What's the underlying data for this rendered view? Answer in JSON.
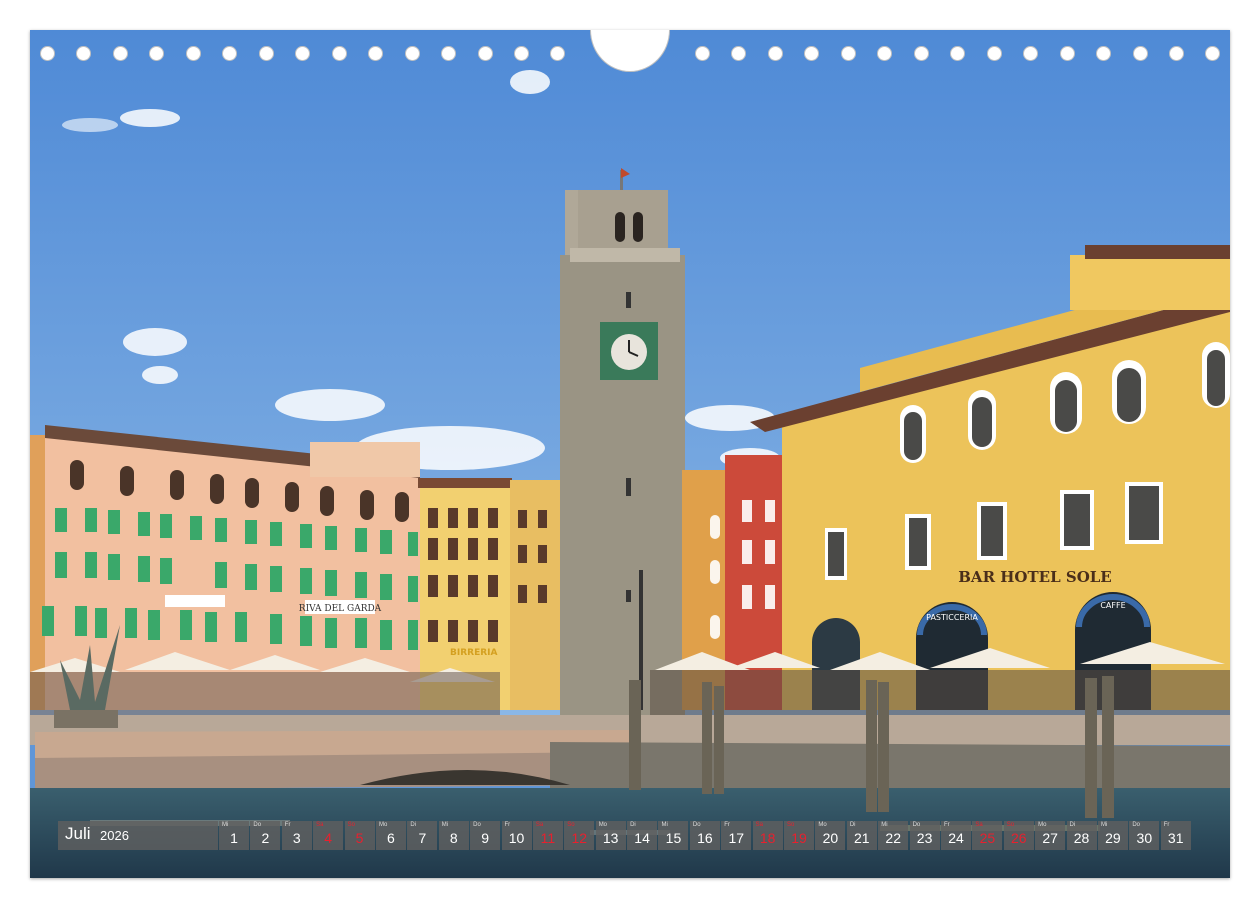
{
  "calendar": {
    "month": "Juli",
    "year": "2026",
    "days": [
      {
        "n": "1",
        "wd": "Mi",
        "weekend": false
      },
      {
        "n": "2",
        "wd": "Do",
        "weekend": false
      },
      {
        "n": "3",
        "wd": "Fr",
        "weekend": false
      },
      {
        "n": "4",
        "wd": "Sa",
        "weekend": true
      },
      {
        "n": "5",
        "wd": "So",
        "weekend": true
      },
      {
        "n": "6",
        "wd": "Mo",
        "weekend": false
      },
      {
        "n": "7",
        "wd": "Di",
        "weekend": false
      },
      {
        "n": "8",
        "wd": "Mi",
        "weekend": false
      },
      {
        "n": "9",
        "wd": "Do",
        "weekend": false
      },
      {
        "n": "10",
        "wd": "Fr",
        "weekend": false
      },
      {
        "n": "11",
        "wd": "Sa",
        "weekend": true
      },
      {
        "n": "12",
        "wd": "So",
        "weekend": true
      },
      {
        "n": "13",
        "wd": "Mo",
        "weekend": false
      },
      {
        "n": "14",
        "wd": "Di",
        "weekend": false
      },
      {
        "n": "15",
        "wd": "Mi",
        "weekend": false
      },
      {
        "n": "16",
        "wd": "Do",
        "weekend": false
      },
      {
        "n": "17",
        "wd": "Fr",
        "weekend": false
      },
      {
        "n": "18",
        "wd": "Sa",
        "weekend": true
      },
      {
        "n": "19",
        "wd": "So",
        "weekend": true
      },
      {
        "n": "20",
        "wd": "Mo",
        "weekend": false
      },
      {
        "n": "21",
        "wd": "Di",
        "weekend": false
      },
      {
        "n": "22",
        "wd": "Mi",
        "weekend": false
      },
      {
        "n": "23",
        "wd": "Do",
        "weekend": false
      },
      {
        "n": "24",
        "wd": "Fr",
        "weekend": false
      },
      {
        "n": "25",
        "wd": "Sa",
        "weekend": true
      },
      {
        "n": "26",
        "wd": "So",
        "weekend": true
      },
      {
        "n": "27",
        "wd": "Mo",
        "weekend": false
      },
      {
        "n": "28",
        "wd": "Di",
        "weekend": false
      },
      {
        "n": "29",
        "wd": "Mi",
        "weekend": false
      },
      {
        "n": "30",
        "wd": "Do",
        "weekend": false
      },
      {
        "n": "31",
        "wd": "Fr",
        "weekend": false
      }
    ]
  },
  "photo": {
    "signs": {
      "hotel_sign": "BAR HOTEL SOLE",
      "pasticceria": "PASTICCERIA",
      "caffe": "CAFFE",
      "riva_del_garda": "RIVA DEL GARDA",
      "birreria": "BIRRERIA"
    }
  },
  "colors": {
    "sky": "#5f96d8",
    "water": "#2d4d5a",
    "yellow_building": "#ecc35a",
    "pink_building": "#f2c0a0",
    "red_building": "#cc4a3a",
    "tower_stone": "#9a9484",
    "shutter_green": "#3aa86a",
    "weekend_red": "#e8202e"
  }
}
